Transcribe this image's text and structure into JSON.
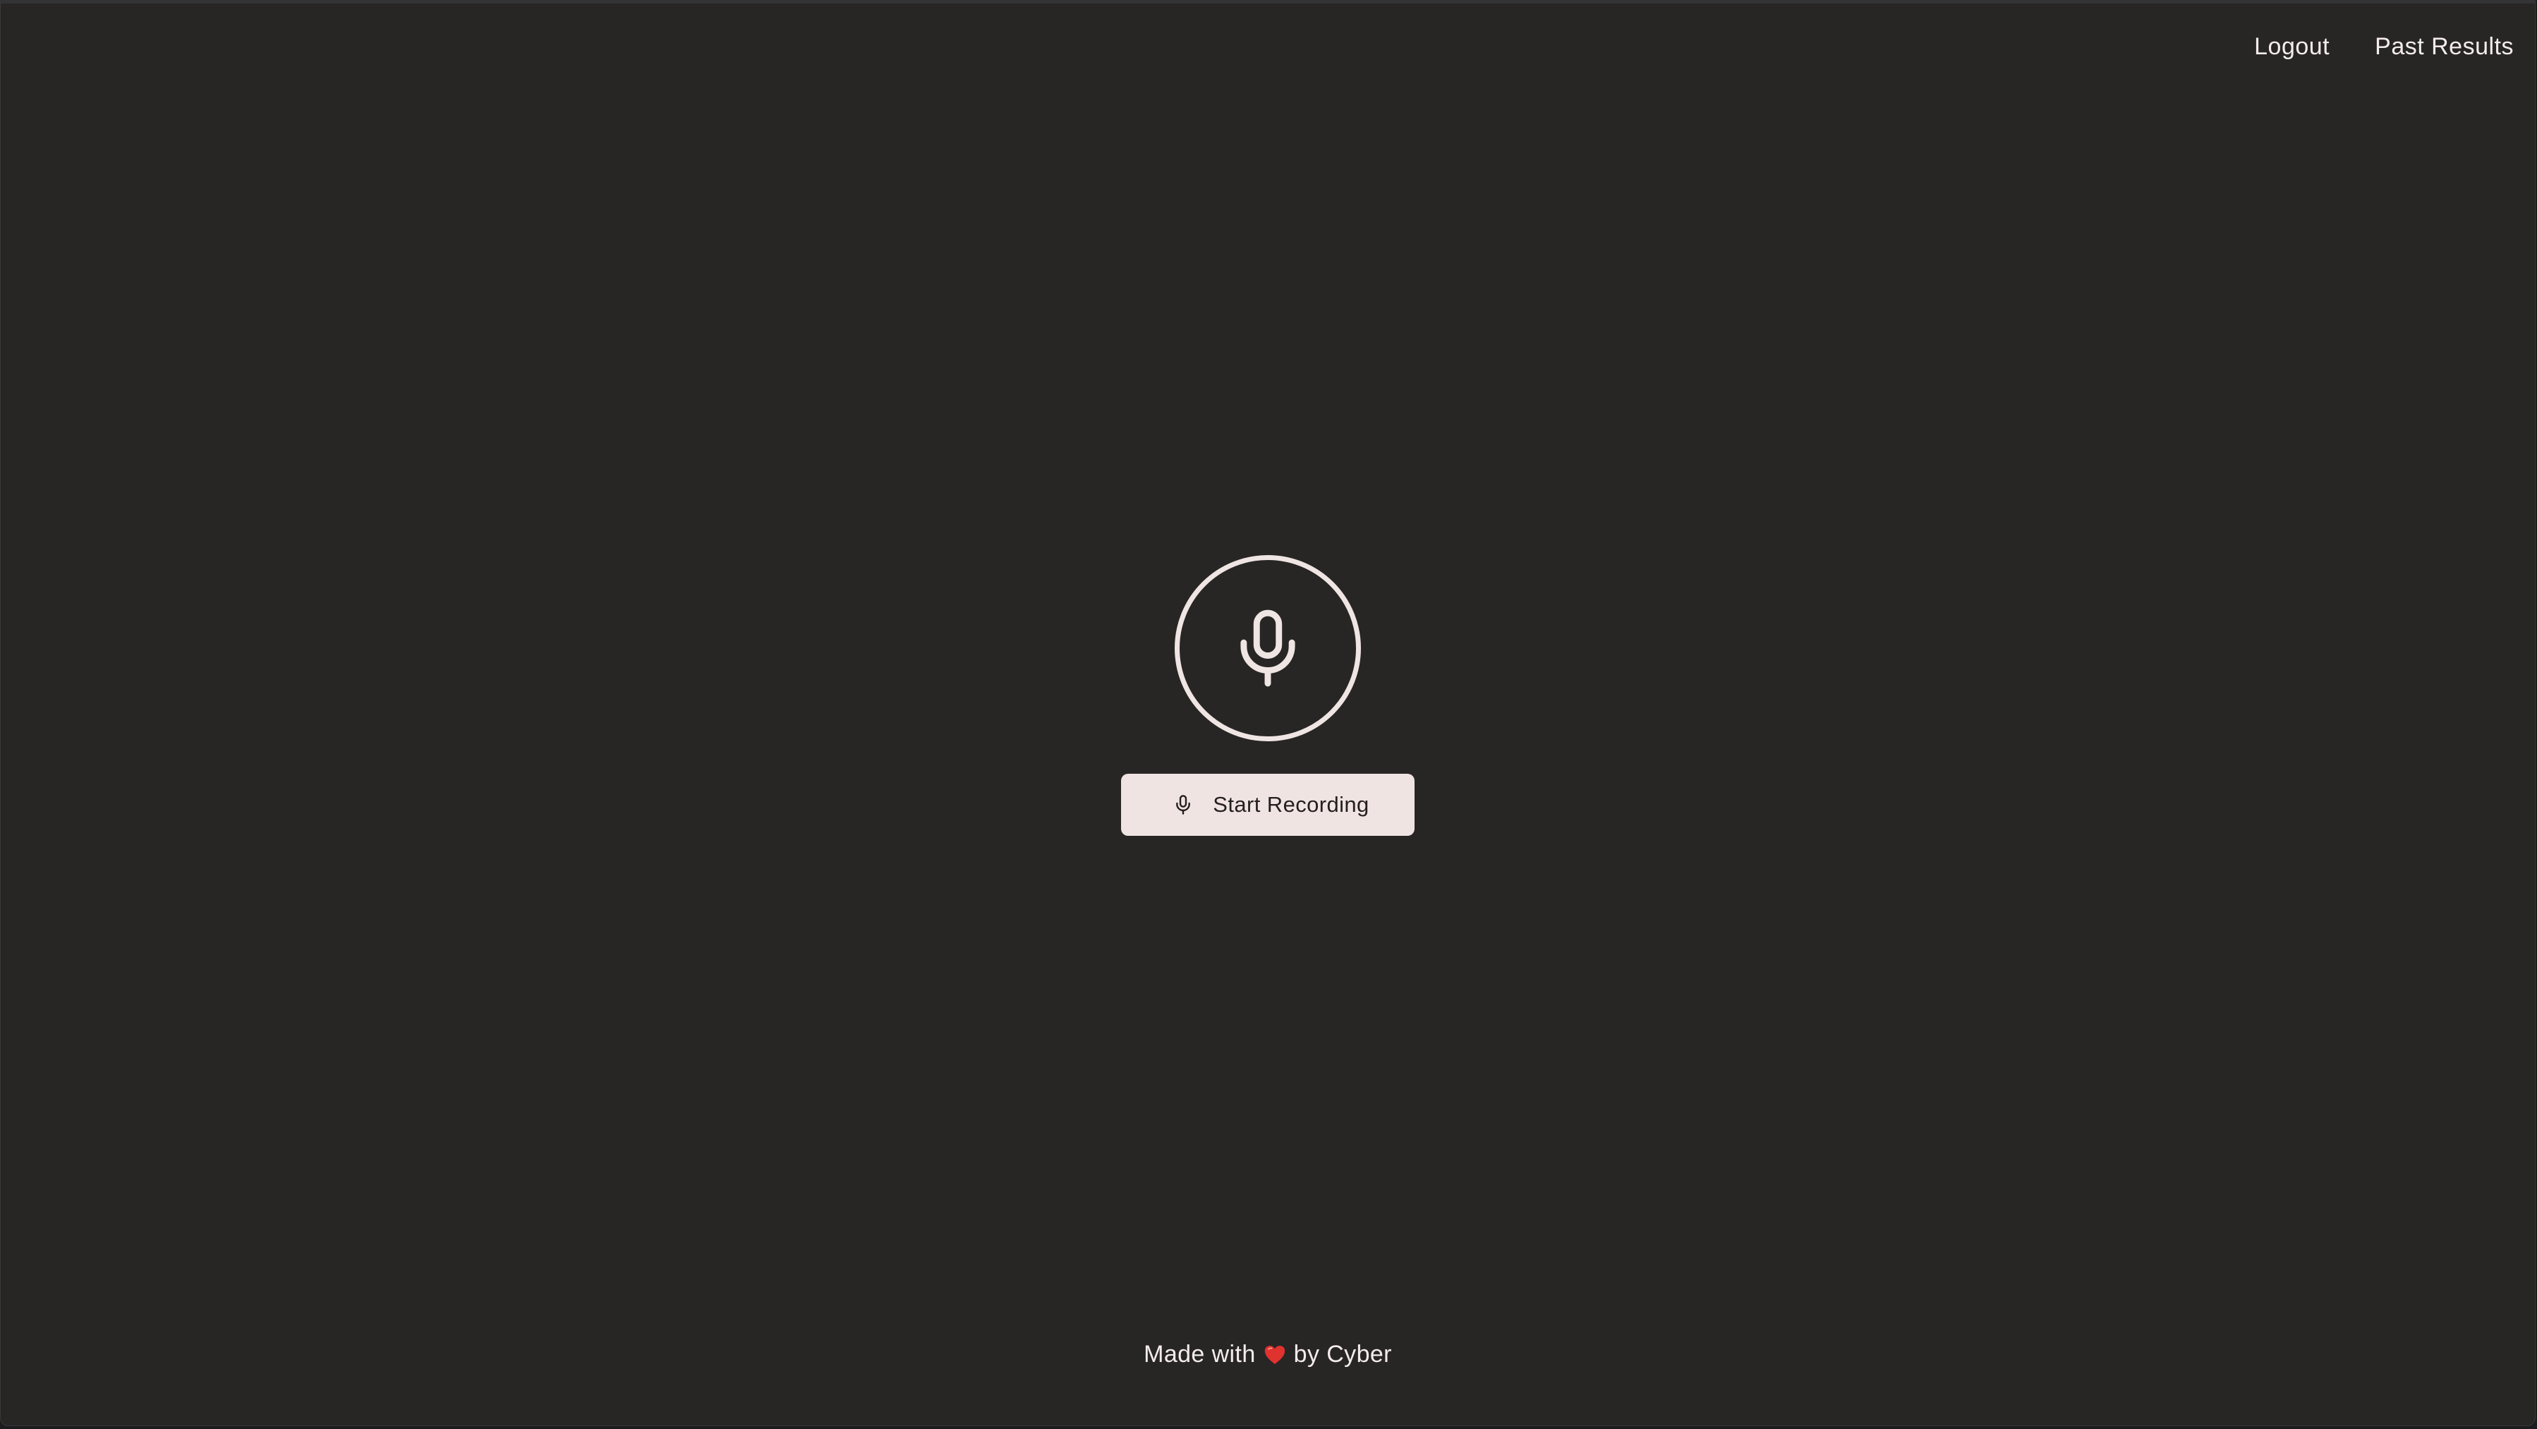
{
  "nav": {
    "logout": "Logout",
    "past_results": "Past Results"
  },
  "recorder": {
    "mic_icon": "microphone-icon",
    "button_icon": "microphone-icon",
    "button_label": "Start Recording"
  },
  "footer": {
    "prefix": "Made with",
    "heart_icon": "heart-icon",
    "suffix": "by Cyber"
  },
  "colors": {
    "background": "#272625",
    "foreground": "#f4ecea",
    "button_bg": "#f0e4e2",
    "button_text": "#231f1e",
    "heart": "#e0322e"
  }
}
